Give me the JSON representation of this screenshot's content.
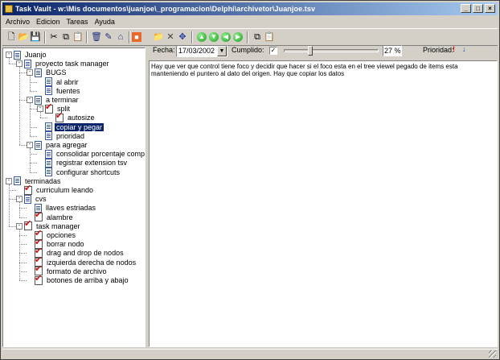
{
  "window": {
    "title": "Task Vault - w:\\Mis documentos\\juanjoe\\_programacion\\Delphi\\archivetor\\Juanjoe.tsv",
    "controls": [
      "minimize",
      "maximize",
      "close"
    ]
  },
  "menu": [
    "Archivo",
    "Edicion",
    "Tareas",
    "Ayuda"
  ],
  "toolbar": {
    "left_icons": [
      "new-icon",
      "open-icon",
      "save-icon",
      "cut-icon",
      "copy-icon",
      "paste-icon",
      "delete-icon",
      "properties-icon",
      "home-icon",
      "stop-icon"
    ],
    "right_icons": [
      "open-folder-icon",
      "cross-icon",
      "move-icon",
      "arrow-up-icon",
      "arrow-down-icon",
      "arrow-left-icon",
      "arrow-right-icon",
      "copy-task-icon",
      "paste-task-icon"
    ]
  },
  "task_props": {
    "fecha_label": "Fecha:",
    "fecha_value": "17/03/2002",
    "cumplido_label": "Cumplido:",
    "cumplido_checked": true,
    "percent_value": "27 %",
    "percent_fraction": 0.27,
    "prioridad_label": "Prioridad:",
    "priority_high_symbol": "!",
    "priority_low_symbol": "↓"
  },
  "tree": [
    {
      "label": "Juanjo",
      "level": 0,
      "expander": "-",
      "icon": "doc"
    },
    {
      "label": "proyecto task manager",
      "level": 1,
      "expander": "-",
      "icon": "doc"
    },
    {
      "label": "BUGS",
      "level": 2,
      "expander": "-",
      "icon": "doc"
    },
    {
      "label": "al abrir",
      "level": 3,
      "expander": "",
      "icon": "doc"
    },
    {
      "label": "fuentes",
      "level": 3,
      "expander": "",
      "icon": "doc"
    },
    {
      "label": "a terminar",
      "level": 2,
      "expander": "-",
      "icon": "doc"
    },
    {
      "label": "split",
      "level": 3,
      "expander": "-",
      "icon": "done"
    },
    {
      "label": "autosize",
      "level": 4,
      "expander": "",
      "icon": "done"
    },
    {
      "label": "copiar y pegar",
      "level": 3,
      "expander": "",
      "icon": "doc",
      "selected": true
    },
    {
      "label": "prioridad",
      "level": 3,
      "expander": "",
      "icon": "doc"
    },
    {
      "label": "para agregar",
      "level": 2,
      "expander": "-",
      "icon": "doc"
    },
    {
      "label": "consolidar porcentaje completa",
      "level": 3,
      "expander": "",
      "icon": "doc"
    },
    {
      "label": "registrar extension tsv",
      "level": 3,
      "expander": "",
      "icon": "doc"
    },
    {
      "label": "configurar shortcuts",
      "level": 3,
      "expander": "",
      "icon": "doc"
    },
    {
      "label": "terminadas",
      "level": 0,
      "expander": "-",
      "icon": "doc"
    },
    {
      "label": "curriculum leando",
      "level": 1,
      "expander": "",
      "icon": "done"
    },
    {
      "label": "cvs",
      "level": 1,
      "expander": "-",
      "icon": "doc"
    },
    {
      "label": "llaves estriadas",
      "level": 2,
      "expander": "",
      "icon": "doc"
    },
    {
      "label": "alambre",
      "level": 2,
      "expander": "",
      "icon": "done"
    },
    {
      "label": "task manager",
      "level": 1,
      "expander": "-",
      "icon": "done"
    },
    {
      "label": "opciones",
      "level": 2,
      "expander": "",
      "icon": "done"
    },
    {
      "label": "borrar nodo",
      "level": 2,
      "expander": "",
      "icon": "done"
    },
    {
      "label": "drag and drop de nodos",
      "level": 2,
      "expander": "",
      "icon": "done"
    },
    {
      "label": "izquierda derecha de nodos",
      "level": 2,
      "expander": "",
      "icon": "done"
    },
    {
      "label": "formato de archivo",
      "level": 2,
      "expander": "",
      "icon": "done"
    },
    {
      "label": "botones de arriba y abajo",
      "level": 2,
      "expander": "",
      "icon": "done"
    }
  ],
  "editor": {
    "text": "Hay que ver que control tiene foco y decidir que hacer si el foco esta en el tree viewel pegado de items esta manteniendo el puntero al dato del origen. Hay que copiar los datos"
  }
}
